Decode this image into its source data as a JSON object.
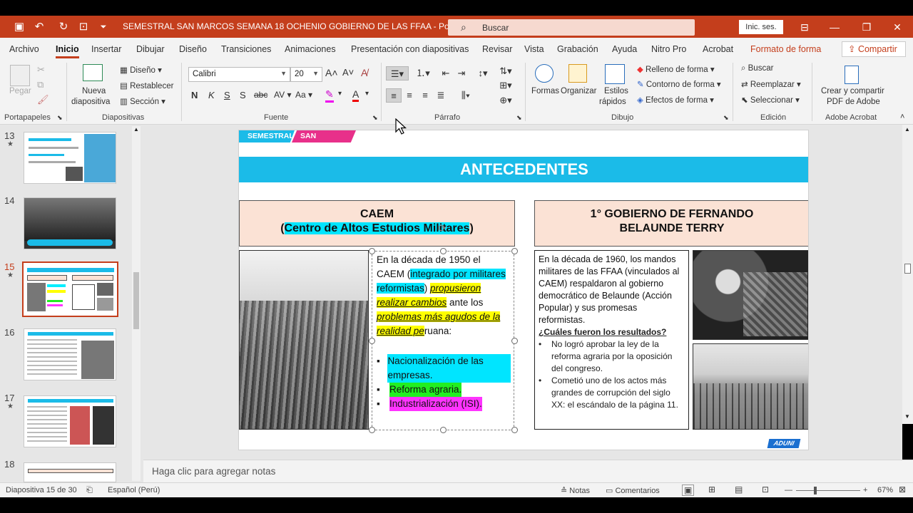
{
  "titlebar": {
    "doc_title": "SEMESTRAL SAN MARCOS SEMANA 18 OCHENIO GOBIERNO DE LAS FFAA  -  PowerPoint",
    "search_placeholder": "Buscar",
    "signin_label": "Inic. ses."
  },
  "menu": {
    "tabs": [
      "Archivo",
      "Inicio",
      "Insertar",
      "Dibujar",
      "Diseño",
      "Transiciones",
      "Animaciones",
      "Presentación con diapositivas",
      "Revisar",
      "Vista",
      "Grabación",
      "Ayuda",
      "Nitro Pro",
      "Acrobat",
      "Formato de forma"
    ],
    "active": "Inicio",
    "share_label": "Compartir"
  },
  "ribbon": {
    "groups": {
      "portapapeles": "Portapapeles",
      "diapositivas": "Diapositivas",
      "fuente": "Fuente",
      "parrafo": "Párrafo",
      "dibujo": "Dibujo",
      "edicion": "Edición",
      "adobe": "Adobe Acrobat"
    },
    "paste_label": "Pegar",
    "new_slide_line1": "Nueva",
    "new_slide_line2": "diapositiva",
    "layout_label": "Diseño",
    "reset_label": "Restablecer",
    "section_label": "Sección",
    "font_name": "Calibri",
    "font_size": "20",
    "shapes_label": "Formas",
    "arrange_label": "Organizar",
    "quick_styles_line1": "Estilos",
    "quick_styles_line2": "rápidos",
    "fill_label": "Relleno de forma",
    "outline_label": "Contorno de forma",
    "effects_label": "Efectos de forma",
    "find_label": "Buscar",
    "replace_label": "Reemplazar",
    "select_label": "Seleccionar",
    "adobe_line1": "Crear y compartir",
    "adobe_line2": "PDF de Adobe"
  },
  "slides_panel": {
    "items": [
      {
        "num": "13"
      },
      {
        "num": "14"
      },
      {
        "num": "15"
      },
      {
        "num": "16"
      },
      {
        "num": "17"
      },
      {
        "num": "18"
      }
    ]
  },
  "slide": {
    "tag1": "SEMESTRAL",
    "tag2": "SAN MARCOS",
    "banner": "ANTECEDENTES",
    "left_box_title": "CAEM",
    "left_box_sub": "Centro de Altos Estudios Militares",
    "text_p1": "En la década de 1950 el CAEM (",
    "text_hl1": "integrado por militares reformistas",
    "text_p2": ") ",
    "text_ul1": "propusieron realizar cambios",
    "text_p3": " ante los ",
    "text_ul2": "problemas más agudos de la realidad pe",
    "text_p4": "ruana:",
    "bullets": [
      "Nacionalización de las empresas.",
      "Reforma agraria.",
      "Industrialización (ISI)."
    ],
    "right_box_title_line1": "1° GOBIERNO DE  FERNANDO",
    "right_box_title_line2": "BELAUNDE TERRY",
    "right_text": "En la década de 1960, los mandos militares de las FFAA (vinculados al CAEM) respaldaron al gobierno democrático de Belaunde (Acción Popular) y sus promesas reformistas.",
    "results_question": "¿Cuáles fueron los resultados?",
    "results": [
      "No logró aprobar la ley de la reforma agraria por la oposición del congreso.",
      "Cometió uno de los actos más grandes de corrupción del siglo XX: el escándalo de la página 11."
    ],
    "logo": "ADUNI"
  },
  "notes_placeholder": "Haga clic para agregar notas",
  "status": {
    "slide_info": "Diapositiva 15 de 30",
    "language": "Español (Perú)",
    "notes": "Notas",
    "comments": "Comentarios",
    "zoom": "67%"
  },
  "colors": {
    "accent": "#c43e1c",
    "banner": "#1bbbe8",
    "tag_pink": "#e8308a",
    "peach": "#fbe2d5"
  }
}
